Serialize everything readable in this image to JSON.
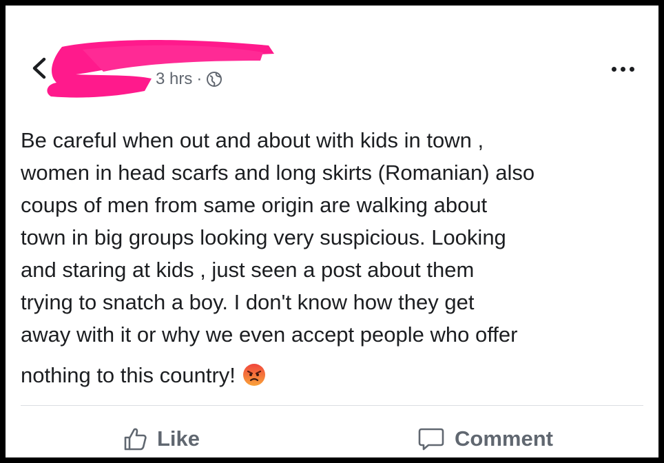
{
  "post": {
    "timestamp": "3 hrs",
    "separator": "·",
    "privacy_icon": "globe-icon",
    "lines": [
      "Be careful when out and about with kids in town ,",
      "women in head scarfs and long skirts (Romanian) also",
      "coups of men from same origin are walking about",
      "town in big groups looking very suspicious. Looking",
      "and staring at kids , just seen a post about them",
      "trying to snatch a boy. I don't know how they get",
      "away with it or why we even accept people who offer",
      "nothing to this country!"
    ],
    "emoji": "angry-face-icon"
  },
  "actions": {
    "like_label": "Like",
    "comment_label": "Comment"
  },
  "colors": {
    "redaction": "#ff1a8c",
    "text": "#1c1e21",
    "muted": "#606770",
    "divider": "#dadde1"
  }
}
